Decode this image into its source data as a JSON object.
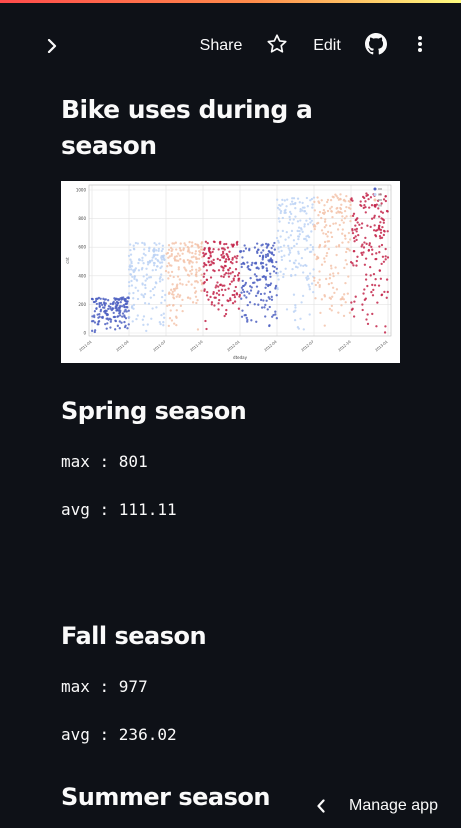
{
  "header": {
    "share_label": "Share",
    "edit_label": "Edit",
    "colors": {
      "stripe_start": "#ff4b4b",
      "stripe_end": "#fffd80"
    },
    "icons": [
      "chevron-right-icon",
      "star-icon",
      "github-icon",
      "more-vertical-icon"
    ]
  },
  "main": {
    "title": "Bike uses during a season",
    "sections": [
      {
        "heading": "Spring season",
        "max": "max : 801",
        "avg": "avg : 111.11"
      },
      {
        "heading": "Fall season",
        "max": "max : 977",
        "avg": "avg : 236.02"
      },
      {
        "heading": "Summer season"
      }
    ]
  },
  "footer": {
    "manage_label": "Manage app",
    "icon": "chevron-left-icon"
  },
  "chart_data": {
    "type": "scatter",
    "ylim": [
      0,
      1000
    ],
    "yticks": [
      "0",
      "200",
      "400",
      "600",
      "800",
      "1000"
    ],
    "xticks": [
      "2011-01",
      "2011-04",
      "2011-07",
      "2011-10",
      "2012-01",
      "2012-04",
      "2012-07",
      "2012-10",
      "2013-01"
    ],
    "xlabel": "dteday",
    "ylabel": "cnt",
    "legend_position": "top-right",
    "series": [
      {
        "color": "#4c5fc1",
        "ranges": [
          [
            0.0,
            0.25,
            0,
            250
          ],
          [
            1.0,
            1.25,
            0,
            630
          ]
        ]
      },
      {
        "color": "#bcd2f5",
        "ranges": [
          [
            0.25,
            0.5,
            0,
            640
          ],
          [
            1.25,
            1.5,
            0,
            950
          ]
        ]
      },
      {
        "color": "#f3c3aa",
        "ranges": [
          [
            0.5,
            0.75,
            0,
            640
          ],
          [
            1.5,
            1.75,
            0,
            980
          ]
        ]
      },
      {
        "color": "#c3244a",
        "ranges": [
          [
            0.75,
            1.0,
            0,
            640
          ],
          [
            1.75,
            2.0,
            0,
            980
          ]
        ]
      }
    ]
  }
}
